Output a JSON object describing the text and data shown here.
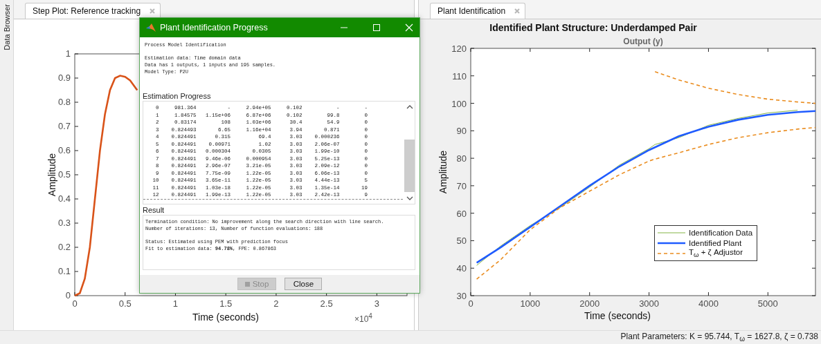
{
  "left_strip": {
    "label": "Data Browser"
  },
  "left_panel": {
    "tab": {
      "label": "Step Plot: Reference tracking",
      "selected": true
    },
    "x_multiplier": "×10$^{4}$",
    "chart_data": {
      "type": "line",
      "xlabel": "Time (seconds)",
      "ylabel": "Amplitude",
      "x": [
        0,
        0.05,
        0.1,
        0.15,
        0.2,
        0.25,
        0.3,
        0.35,
        0.4,
        0.45,
        0.5,
        0.55,
        0.62
      ],
      "series": [
        {
          "color": "#d95319",
          "line_style": "solid",
          "values": [
            0,
            0.01,
            0.07,
            0.2,
            0.4,
            0.6,
            0.75,
            0.85,
            0.9,
            0.91,
            0.905,
            0.89,
            0.85
          ]
        }
      ],
      "xlim": [
        0,
        3.3
      ],
      "ylim": [
        0,
        1
      ],
      "xticks": [
        0,
        0.5,
        1,
        1.5,
        2,
        2.5,
        3
      ],
      "yticks": [
        0,
        0.1,
        0.2,
        0.3,
        0.4,
        0.5,
        0.6,
        0.7,
        0.8,
        0.9,
        1
      ]
    }
  },
  "right_panel": {
    "tab": {
      "label": "Plant Identification",
      "selected": true
    },
    "title": "Identified Plant Structure: Underdamped Pair",
    "chart_data": {
      "type": "line",
      "title": "Output (y)",
      "xlabel": "Time (seconds)",
      "ylabel": "Amplitude",
      "x": [
        100,
        500,
        1000,
        1500,
        2000,
        2500,
        3000,
        3100,
        3500,
        4000,
        4500,
        5000,
        5500,
        5800
      ],
      "series": [
        {
          "name": "Identification Data",
          "color": "#77ac30",
          "line_style": "solid",
          "values": [
            41,
            48,
            55.5,
            62,
            69.5,
            77.5,
            83.5,
            85,
            87.5,
            92,
            94.5,
            96.5,
            97.5,
            null
          ]
        },
        {
          "name": "Identified Plant",
          "color": "#1f5bff",
          "line_style": "solid",
          "values": [
            42,
            47.5,
            55,
            62.5,
            70,
            77,
            83,
            84,
            88,
            91.5,
            94,
            95.8,
            96.8,
            97.2
          ]
        },
        {
          "name": "T$_{ω}$ + ζ Adjustor",
          "color": "#ea8c1e",
          "line_style": "dashed",
          "values": [
            null,
            null,
            null,
            null,
            null,
            null,
            null,
            111.5,
            108.5,
            105.5,
            103.2,
            101.5,
            100.5,
            100
          ]
        },
        {
          "color": "#ea8c1e",
          "line_style": "dashed",
          "values": [
            36,
            43,
            54,
            62,
            68,
            74,
            79,
            79.7,
            82,
            85,
            87.5,
            89.3,
            90.6,
            91.2
          ]
        }
      ],
      "xlim": [
        0,
        5800
      ],
      "ylim": [
        30,
        120
      ],
      "xticks": [
        0,
        1000,
        2000,
        3000,
        4000,
        5000
      ],
      "yticks": [
        30,
        40,
        50,
        60,
        70,
        80,
        90,
        100,
        110,
        120
      ]
    }
  },
  "dialog": {
    "title": "Plant Identification Progress",
    "header": [
      [
        "Process Model Identification"
      ],
      [
        "Estimation data: Time domain data",
        "Data has 1 outputs, 1 inputs and 195 samples.",
        "Model Type: P2U"
      ]
    ],
    "progress_label": "Estimation Progress",
    "progress_log": [
      "    0     981.364          -     2.94e+05     0.102           -        -",
      "    1     1.84575   1.15e+06     6.87e+06     0.102        99.8        0",
      "    2     0.83174        108     1.03e+06      30.4        54.9        0",
      "    3    0.824493       6.65     1.16e+04      3.94       0.871        0",
      "    4    0.824491      0.315         69.4      3.03    0.000236        0",
      "    5    0.824491    0.00971         1.02      3.03    2.06e-07        0",
      "    6    0.824491   0.000304       0.0305      3.03    1.99e-10        0",
      "    7    0.824491   9.46e-06     0.000954      3.03    5.25e-13        0",
      "    8    0.824491   2.96e-07     3.21e-05      3.03    2.09e-12        0",
      "    9    0.824491   7.75e-09     1.22e-05      3.03    6.06e-13        0",
      "   10    0.824491   3.65e-11     1.22e-05      3.03    4.44e-13        5",
      "   11    0.824491   1.03e-18     1.22e-05      3.03    1.35e-14       19",
      "   12    0.824491   1.99e-13     1.22e-05      3.03    2.42e-13        9"
    ],
    "result_label": "Result",
    "result": [
      [
        "Termination condition: No improvement along the search direction with line search.",
        "Number of iterations: 13, Number of function evaluations: 188"
      ],
      [
        "Status: Estimated using PEM with prediction focus",
        "Fit to estimation data: **94.78%**, FPE: 0.867863"
      ]
    ],
    "buttons": [
      {
        "label": "Stop",
        "kind": "stop",
        "disabled": true
      },
      {
        "label": "Close",
        "kind": "plain",
        "disabled": false
      }
    ]
  },
  "status_bar": {
    "text": "Plant Parameters: K = 95.744, T$_{ω}$ = 1627.8, ζ = 0.738"
  }
}
